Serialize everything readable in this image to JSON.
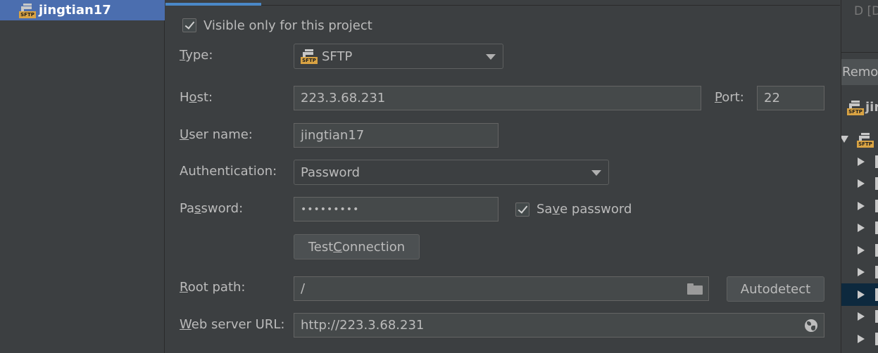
{
  "left_panel": {
    "server_name": "jingtian17",
    "server_icon_tag": "SFTP"
  },
  "form": {
    "visible_only_label": "Visible only for this project",
    "visible_only_checked": true,
    "type_label_mnemonic": "T",
    "type_label_rest": "ype:",
    "type_value": "SFTP",
    "type_icon_tag": "SFTP",
    "host_label_pre": "H",
    "host_label_mnemonic": "o",
    "host_label_post": "st:",
    "host_value": "223.3.68.231",
    "port_label_mnemonic": "P",
    "port_label_rest": "ort:",
    "port_value": "22",
    "username_label_mnemonic": "U",
    "username_label_rest": "ser name:",
    "username_value": "jingtian17",
    "auth_label": "Authentication:",
    "auth_value": "Password",
    "password_label_pre": "Pa",
    "password_label_mnemonic": "s",
    "password_label_post": "sword:",
    "password_value": "•••••••••",
    "save_password_pre": "Sa",
    "save_password_mnemonic": "v",
    "save_password_post": "e password",
    "save_password_checked": true,
    "test_connection_pre": "Test ",
    "test_connection_mnemonic": "C",
    "test_connection_post": "onnection",
    "root_path_label_mnemonic": "R",
    "root_path_label_rest": "oot path:",
    "root_path_value": "/",
    "autodetect_label": "Autodetect",
    "web_url_label_mnemonic": "W",
    "web_url_label_rest": "eb server URL:",
    "web_url_value": "http://223.3.68.231"
  },
  "right_panel": {
    "top_label": "D [D",
    "header_label": "Remot",
    "server_label": "jir",
    "tree_icon_tag": "SFTP"
  },
  "colors": {
    "background": "#3c3f41",
    "selection": "#4b6eaf",
    "accent": "#4a88c7",
    "field": "#45494a",
    "tree_selection": "#0d293e"
  }
}
